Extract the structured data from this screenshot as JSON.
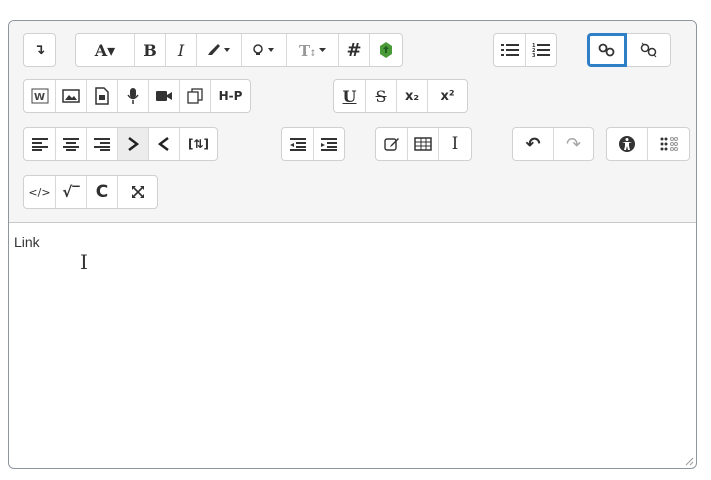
{
  "editor": {
    "content_text": "Link",
    "toolbar": {
      "collapse_icon": "↴",
      "font_label": "A▾",
      "bold_label": "B",
      "italic_label": "I",
      "underline_label": "U",
      "strikethrough_label": "S",
      "subscript_label": "x₂",
      "superscript_label": "x²",
      "hashtag_label": "#",
      "h5p_label": "H-P",
      "code_label": "</>",
      "sqrt_label": "√‾",
      "c_label": "C",
      "ibeam_label": "I",
      "bracket_label": "[⇅]",
      "undo_label": "↶",
      "redo_label": "↷"
    }
  },
  "colors": {
    "accent": "#2f7fc7",
    "toolbar_bg": "#f5f5f5"
  }
}
